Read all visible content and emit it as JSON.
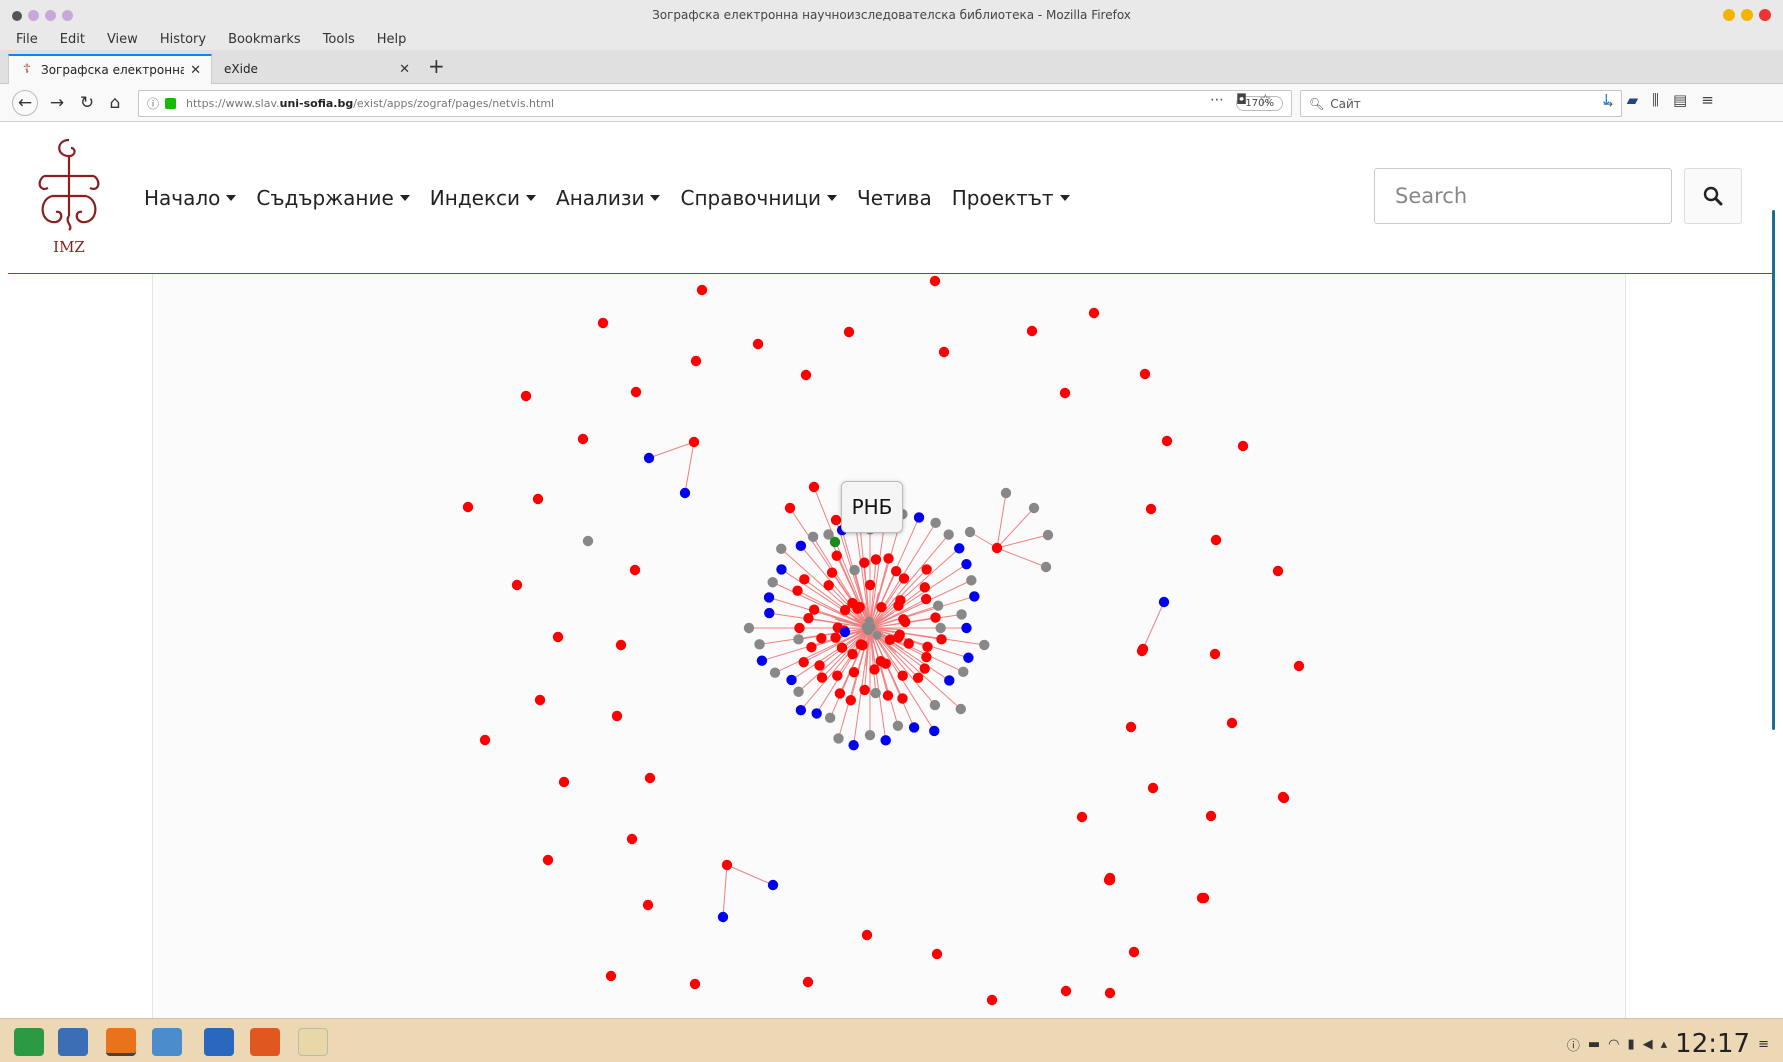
{
  "window": {
    "title": "Зографска електронна научноизследователска библиотека - Mozilla Firefox"
  },
  "menu": [
    "File",
    "Edit",
    "View",
    "History",
    "Bookmarks",
    "Tools",
    "Help"
  ],
  "tabs": [
    {
      "label": "Зографска електронна нау"
    },
    {
      "label": "eXide"
    }
  ],
  "address": {
    "prefix": "https://www.slav.",
    "domain": "uni-sofia.bg",
    "path": "/exist/apps/zograf/pages/netvis.html",
    "zoom": "170%"
  },
  "browser_search": {
    "placeholder": "Сайт"
  },
  "site": {
    "logo_text": "IMZ",
    "nav": [
      {
        "label": "Начало",
        "dropdown": true
      },
      {
        "label": "Съдържание",
        "dropdown": true
      },
      {
        "label": "Индекси",
        "dropdown": true
      },
      {
        "label": "Анализи",
        "dropdown": true
      },
      {
        "label": "Справочници",
        "dropdown": true
      },
      {
        "label": "Четива",
        "dropdown": false
      },
      {
        "label": "Проектът",
        "dropdown": true
      }
    ],
    "search_placeholder": "Search"
  },
  "graph": {
    "tooltip": "РНБ",
    "colors": {
      "red": "#ff0000",
      "blue": "#0000ee",
      "gray": "#888888",
      "green": "#1a8a1a",
      "edge": "#f08080"
    }
  },
  "taskbar": {
    "clock": "12:17"
  }
}
